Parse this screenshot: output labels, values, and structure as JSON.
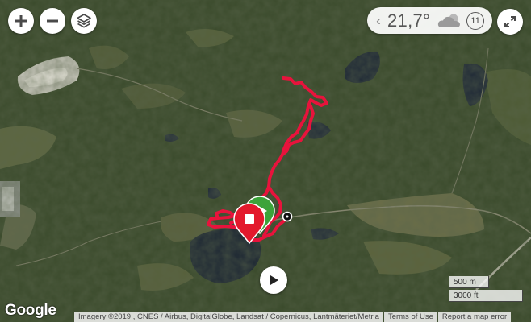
{
  "map": {
    "type": "satellite",
    "colors": {
      "route": "#e8133c",
      "start_marker": "#3ca33a",
      "end_marker": "#e3192c",
      "forest": "#2f3e22",
      "water": "#1f2a3a"
    }
  },
  "controls": {
    "zoom_in_icon": "plus-icon",
    "zoom_out_icon": "minus-icon",
    "layers_icon": "layers-icon",
    "fullscreen_icon": "expand-icon",
    "play_icon": "play-icon"
  },
  "weather": {
    "chevron": "‹",
    "temperature": "21,7°",
    "condition_icon": "cloud-icon",
    "wind_speed": "11"
  },
  "scale": {
    "metric": "500 m",
    "imperial": "3000 ft"
  },
  "logo": "Google",
  "attribution": {
    "imagery": "Imagery ©2019 , CNES / Airbus, DigitalGlobe, Landsat / Copernicus, Lantmäteriet/Metria",
    "terms": "Terms of Use",
    "report": "Report a map error"
  }
}
